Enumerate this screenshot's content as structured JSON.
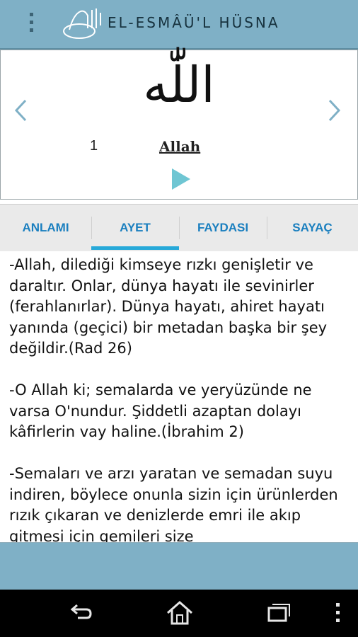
{
  "header": {
    "title": "EL-ESMÂÜ'L HÜSNA"
  },
  "name_panel": {
    "arabic_text": "اللّٰه",
    "number": "1",
    "latin_name": "Allah"
  },
  "tabs": [
    {
      "label": "ANLAMI"
    },
    {
      "label": "AYET"
    },
    {
      "label": "FAYDASI"
    },
    {
      "label": "SAYAÇ"
    }
  ],
  "selected_tab": "AYET",
  "content": {
    "text": "-Allah, dilediği kimseye rızkı genişletir ve daraltır. Onlar, dünya hayatı ile sevinirler (ferahlanırlar). Dünya hayatı, ahiret hayatı yanında (geçici) bir metadan başka bir şey değildir.(Rad 26)\n\n-O Allah ki; semalarda ve yeryüzünde ne varsa O'nundur. Şiddetli azaptan dolayı kâfirlerin vay haline.(İbrahim 2)\n\n-Semaları ve arzı yaratan ve semadan suyu indiren, böylece onunla sizin için ürünlerden rızık çıkaran ve denizlerde emri ile akıp gitmesi için gemileri size"
  },
  "colors": {
    "header_bg": "#7fb0c6",
    "tab_text": "#1a7fbf",
    "tab_indicator": "#27a9d9",
    "play_button": "#6fc6d3",
    "nav_arrow": "#7fb0c6"
  },
  "icons": {
    "menu": "overflow-menu-icon",
    "logo": "calligraphy-logo-icon",
    "prev": "chevron-left-icon",
    "next": "chevron-right-icon",
    "play": "play-icon",
    "back": "back-icon",
    "home": "home-icon",
    "recents": "recents-icon",
    "more": "more-vertical-icon"
  }
}
